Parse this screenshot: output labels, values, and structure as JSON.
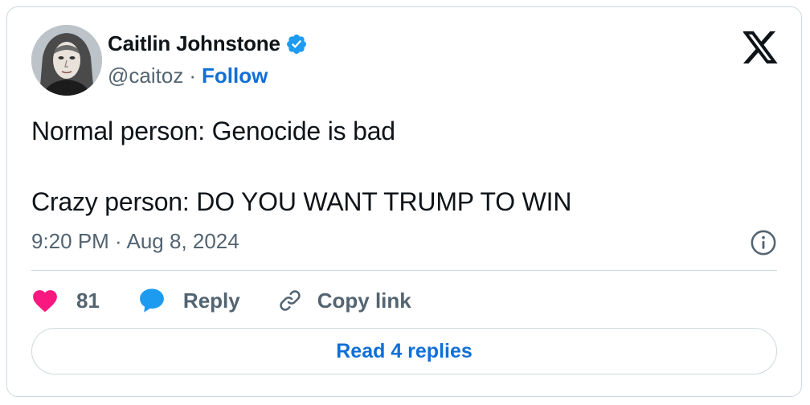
{
  "author": {
    "name": "Caitlin Johnstone",
    "handle": "@caitoz",
    "separator": "·",
    "follow_label": "Follow",
    "verified_color": "#1d9bf0"
  },
  "tweet": {
    "text": "Normal person: Genocide is bad\n\nCrazy person: DO YOU WANT TRUMP TO WIN",
    "timestamp": "9:20 PM · Aug 8, 2024"
  },
  "actions": {
    "like_count": "81",
    "reply_label": "Reply",
    "copy_link_label": "Copy link",
    "like_color": "#f91880",
    "reply_color": "#1d9bf0"
  },
  "read_replies_label": "Read 4 replies",
  "icons": {
    "logo": "x-logo-icon",
    "verified": "verified-badge-icon",
    "info": "info-icon",
    "like": "heart-icon",
    "reply": "speech-bubble-icon",
    "copy": "link-icon"
  },
  "colors": {
    "text": "#0f1419",
    "secondary": "#536471",
    "link": "#0f6fd6",
    "border": "#cfd9de"
  }
}
